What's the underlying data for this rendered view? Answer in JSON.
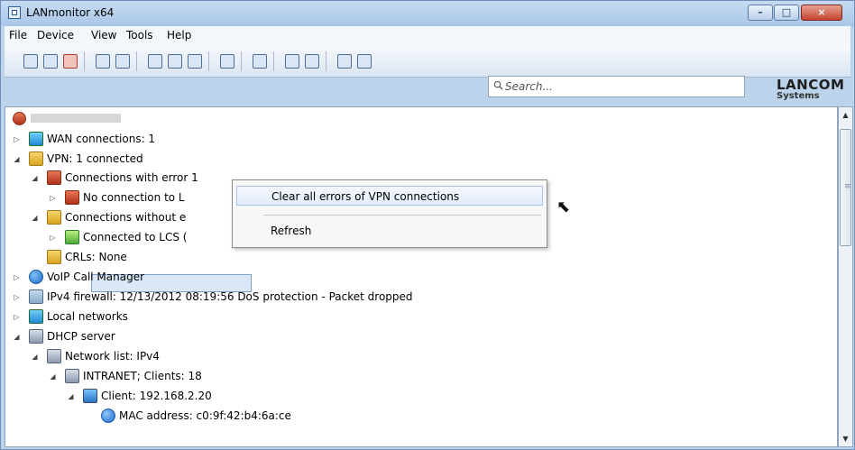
{
  "window": {
    "title": "LANmonitor x64",
    "controls": [
      "minimize",
      "maximize",
      "close"
    ]
  },
  "menubar": {
    "items": [
      "File",
      "Device",
      "View",
      "Tools",
      "Help"
    ]
  },
  "search": {
    "placeholder": "Search..."
  },
  "brand": {
    "name": "LANCOM",
    "sub": "Systems"
  },
  "tree": {
    "root": "",
    "items": [
      {
        "label": "WAN connections: 1",
        "icon": "network-icon"
      },
      {
        "label": "VPN: 1 connected",
        "icon": "lock-icon"
      },
      {
        "label": "Connections with error 1",
        "icon": "error-lock-icon"
      },
      {
        "label": "No connection to L",
        "icon": "error-lock-icon"
      },
      {
        "label": "Connections without e",
        "icon": "lock-icon"
      },
      {
        "label": "Connected to LCS (",
        "icon": "arrow-icon"
      },
      {
        "label": "CRLs: None",
        "icon": "lock-icon"
      },
      {
        "label": "VoIP Call Manager",
        "icon": "phone-icon"
      },
      {
        "label": "IPv4 firewall: 12/13/2012 08:19:56 DoS protection - Packet dropped",
        "icon": "firewall-icon"
      },
      {
        "label": "Local networks",
        "icon": "network-icon"
      },
      {
        "label": "DHCP server",
        "icon": "server-icon"
      },
      {
        "label": "Network list: IPv4",
        "icon": "server-icon"
      },
      {
        "label": "INTRANET; Clients: 18",
        "icon": "server-icon"
      },
      {
        "label": "Client: 192.168.2.20",
        "icon": "monitor-icon"
      },
      {
        "label": "MAC address: c0:9f:42:b4:6a:ce",
        "icon": "info-icon"
      }
    ]
  },
  "context_menu": {
    "items": [
      "Clear all errors of VPN connections",
      "Refresh"
    ]
  }
}
